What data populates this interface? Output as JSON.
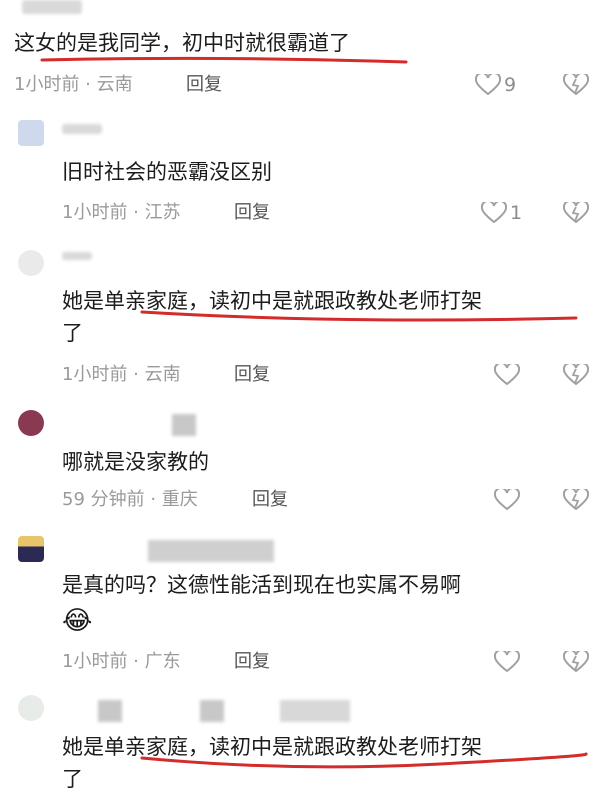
{
  "comments": [
    {
      "text": "这女的是我同学，初中时就很霸道了",
      "meta": "1小时前 · 云南",
      "reply": "回复",
      "likes": "9"
    },
    {
      "text": "旧时社会的恶霸没区别",
      "meta": "1小时前 · 江苏",
      "reply": "回复",
      "likes": "1"
    },
    {
      "text_line1": "她是单亲家庭，读初中是就跟政教处老师打架",
      "text_line2": "了",
      "meta": "1小时前 · 云南",
      "reply": "回复"
    },
    {
      "text": "哪就是没家教的",
      "meta": "59 分钟前 · 重庆",
      "reply": "回复"
    },
    {
      "text": "是真的吗？这德性能活到现在也实属不易啊",
      "emoji": "😂",
      "meta": "1小时前 · 广东",
      "reply": "回复"
    },
    {
      "text_line1": "她是单亲家庭，读初中是就跟政教处老师打架",
      "text_line2": "了"
    }
  ],
  "colors": {
    "underline": "#d42b2b",
    "meta": "#9a9a9a",
    "icon": "#a0a0a0"
  },
  "icons": [
    "heart-icon",
    "dislike-heart-icon"
  ]
}
